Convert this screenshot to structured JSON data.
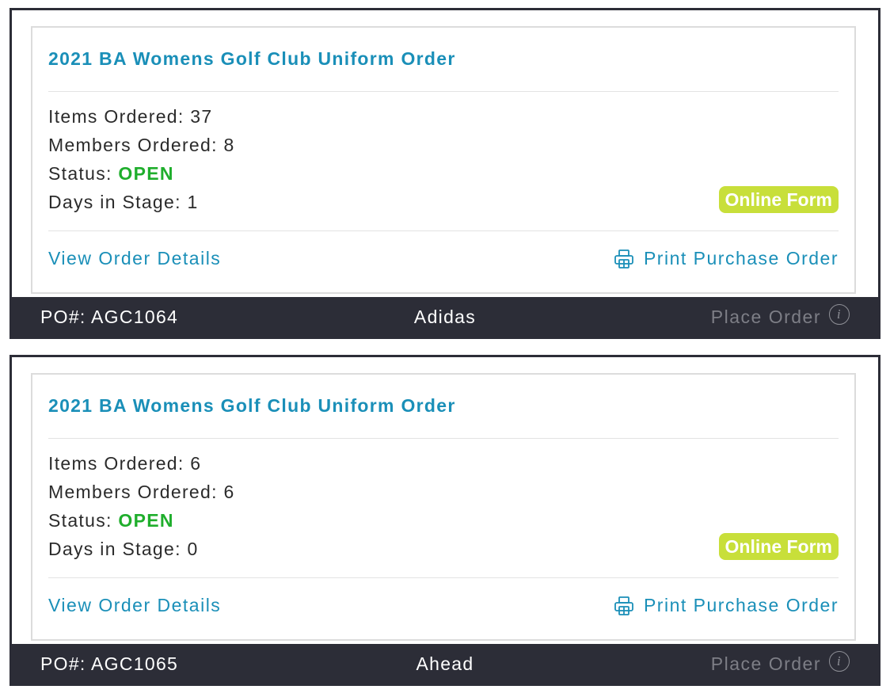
{
  "orders": [
    {
      "title": "2021 BA Womens Golf Club Uniform Order",
      "items_label": "Items Ordered: ",
      "items_value": "37",
      "members_label": "Members Ordered: ",
      "members_value": "8",
      "status_label": "Status: ",
      "status_value": "OPEN",
      "days_label": "Days in Stage: ",
      "days_value": "1",
      "badge": "Online Form",
      "view_link": "View Order Details",
      "print_link": "Print Purchase Order",
      "po_number": "PO#: AGC1064",
      "vendor": "Adidas",
      "place_order": "Place Order",
      "info_glyph": "i"
    },
    {
      "title": "2021 BA Womens Golf Club Uniform Order",
      "items_label": "Items Ordered: ",
      "items_value": "6",
      "members_label": "Members Ordered: ",
      "members_value": "6",
      "status_label": "Status: ",
      "status_value": "OPEN",
      "days_label": "Days in Stage: ",
      "days_value": "0",
      "badge": "Online Form",
      "view_link": "View Order Details",
      "print_link": "Print Purchase Order",
      "po_number": "PO#: AGC1065",
      "vendor": "Ahead",
      "place_order": "Place Order",
      "info_glyph": "i"
    }
  ],
  "colors": {
    "link": "#1a8fb8",
    "status_open": "#1fae2c",
    "badge_bg": "#c8df3a",
    "footer_bg": "#2c2d37",
    "disabled_text": "#7d7e86"
  },
  "icons": {
    "print": "printer-icon",
    "info": "info-circle-icon"
  }
}
